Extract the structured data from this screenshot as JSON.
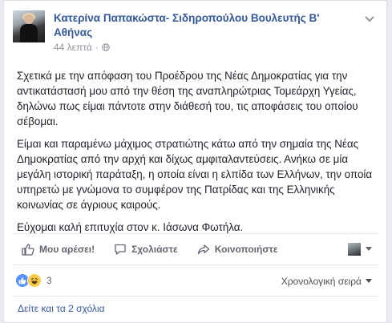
{
  "post": {
    "author": "Κατερίνα Παπακώστα- Σιδηροπούλου Βουλευτής Β' Αθήνας",
    "timestamp": "44 λεπτά",
    "paragraphs": [
      "Σχετικά με την απόφαση του Προέδρου της Νέας Δημοκρατίας για την αντικατάστασή μου από την θέση της αναπληρώτριας Τομεάρχη Υγείας, δηλώνω πως είμαι πάντοτε στην διάθεσή του, τις αποφάσεις του οποίου σέβομαι.",
      "Είμαι και παραμένω μάχιμος στρατιώτης κάτω από την σημαία της Νέας Δημοκρατίας από την αρχή και δίχως αμφιταλαντεύσεις. Ανήκω σε μία μεγάλη ιστορική παράταξη, η οποία είναι η ελπίδα των Ελλήνων, την οποία υπηρετώ με γνώμονα το συμφέρον της Πατρίδας και της Ελληνικής κοινωνίας σε άγριους καιρούς.",
      "Εύχομαι καλή επιτυχία στον κ. Ιάσωνα Φωτήλα."
    ]
  },
  "actions": {
    "like": "Μου αρέσει!",
    "comment": "Σχολιάστε",
    "share": "Κοινοποιήστε"
  },
  "reactions": {
    "count": "3",
    "sort_label": "Χρονολογική σειρά"
  },
  "comments": {
    "view_more": "Δείτε και τα 2 σχόλια"
  },
  "colors": {
    "link": "#365899",
    "secondary": "#90949c",
    "like_blue": "#5890ff",
    "haha_yellow": "#f7cc4b"
  }
}
